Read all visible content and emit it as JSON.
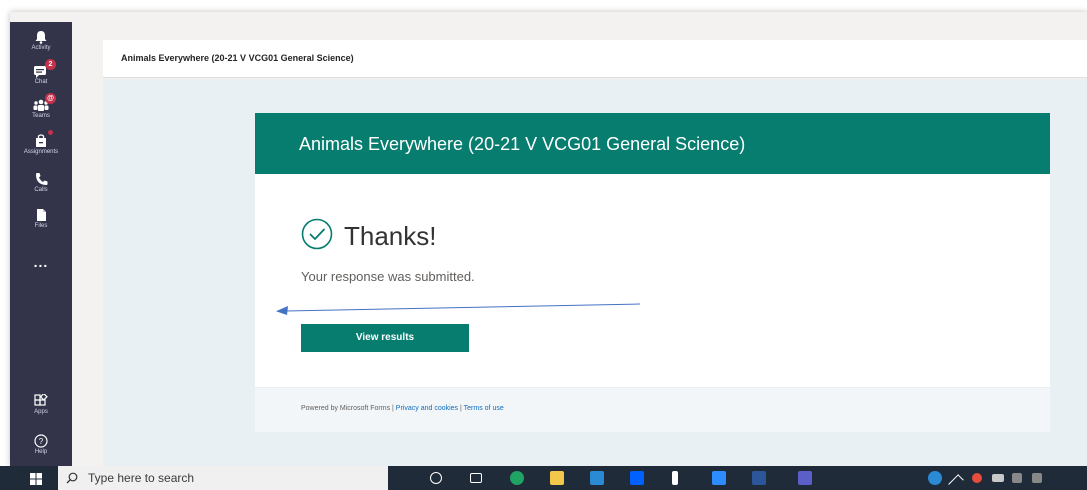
{
  "rail": {
    "items": [
      {
        "label": "Activity",
        "icon": "bell-icon"
      },
      {
        "label": "Chat",
        "icon": "chat-icon",
        "badge": "2"
      },
      {
        "label": "Teams",
        "icon": "teams-icon",
        "badge": "@"
      },
      {
        "label": "Assignments",
        "icon": "assignments-icon"
      },
      {
        "label": "Calls",
        "icon": "phone-icon"
      },
      {
        "label": "Files",
        "icon": "file-icon"
      },
      {
        "label": "Apps",
        "icon": "apps-icon"
      },
      {
        "label": "Help",
        "icon": "help-icon"
      }
    ],
    "more": "..."
  },
  "header": {
    "title": "Animals Everywhere (20-21 V VCG01 General Science)"
  },
  "form": {
    "title": "Animals Everywhere (20-21 V VCG01 General Science)",
    "thanks": "Thanks!",
    "submitted": "Your response was submitted.",
    "view_results": "View results"
  },
  "footer": {
    "powered": "Powered by Microsoft Forms | ",
    "privacy": "Privacy and cookies",
    "sep": " | ",
    "terms": "Terms of use"
  },
  "taskbar": {
    "search_placeholder": "Type here to search"
  },
  "colors": {
    "rail": "#33344a",
    "accent": "#077d6f",
    "arrow": "#4472c4",
    "badge": "#c4314b"
  }
}
